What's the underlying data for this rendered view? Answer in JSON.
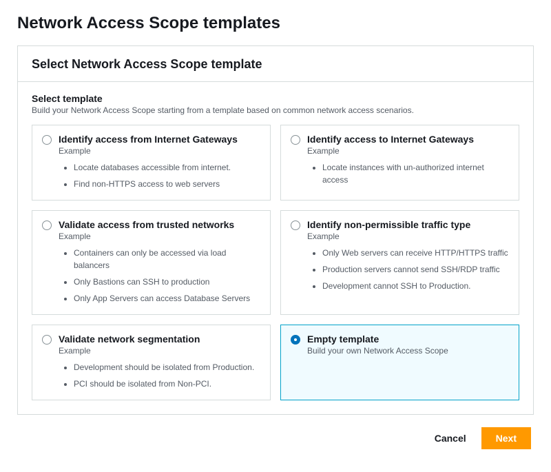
{
  "page_title": "Network Access Scope templates",
  "panel": {
    "heading": "Select Network Access Scope template",
    "section_title": "Select template",
    "section_desc": "Build your Network Access Scope starting from a template based on common network access scenarios."
  },
  "cards": {
    "internet_from": {
      "title": "Identify access from Internet Gateways",
      "sub": "Example",
      "examples": [
        "Locate databases accessible from internet.",
        "Find non-HTTPS access to web servers"
      ]
    },
    "internet_to": {
      "title": "Identify access to Internet Gateways",
      "sub": "Example",
      "examples": [
        "Locate instances with un-authorized internet access"
      ]
    },
    "trusted": {
      "title": "Validate access from trusted networks",
      "sub": "Example",
      "examples": [
        "Containers can only be accessed via load balancers",
        "Only Bastions can SSH to production",
        "Only App Servers can access Database Servers"
      ]
    },
    "nonperm": {
      "title": "Identify non-permissible traffic type",
      "sub": "Example",
      "examples": [
        "Only Web servers can receive HTTP/HTTPS traffic",
        "Production servers cannot send SSH/RDP traffic",
        "Development cannot SSH to Production."
      ]
    },
    "segmentation": {
      "title": "Validate network segmentation",
      "sub": "Example",
      "examples": [
        "Development should be isolated from Production.",
        "PCI should be isolated from Non-PCI."
      ]
    },
    "empty": {
      "title": "Empty template",
      "sub": "Build your own Network Access Scope"
    }
  },
  "footer": {
    "cancel": "Cancel",
    "next": "Next"
  }
}
